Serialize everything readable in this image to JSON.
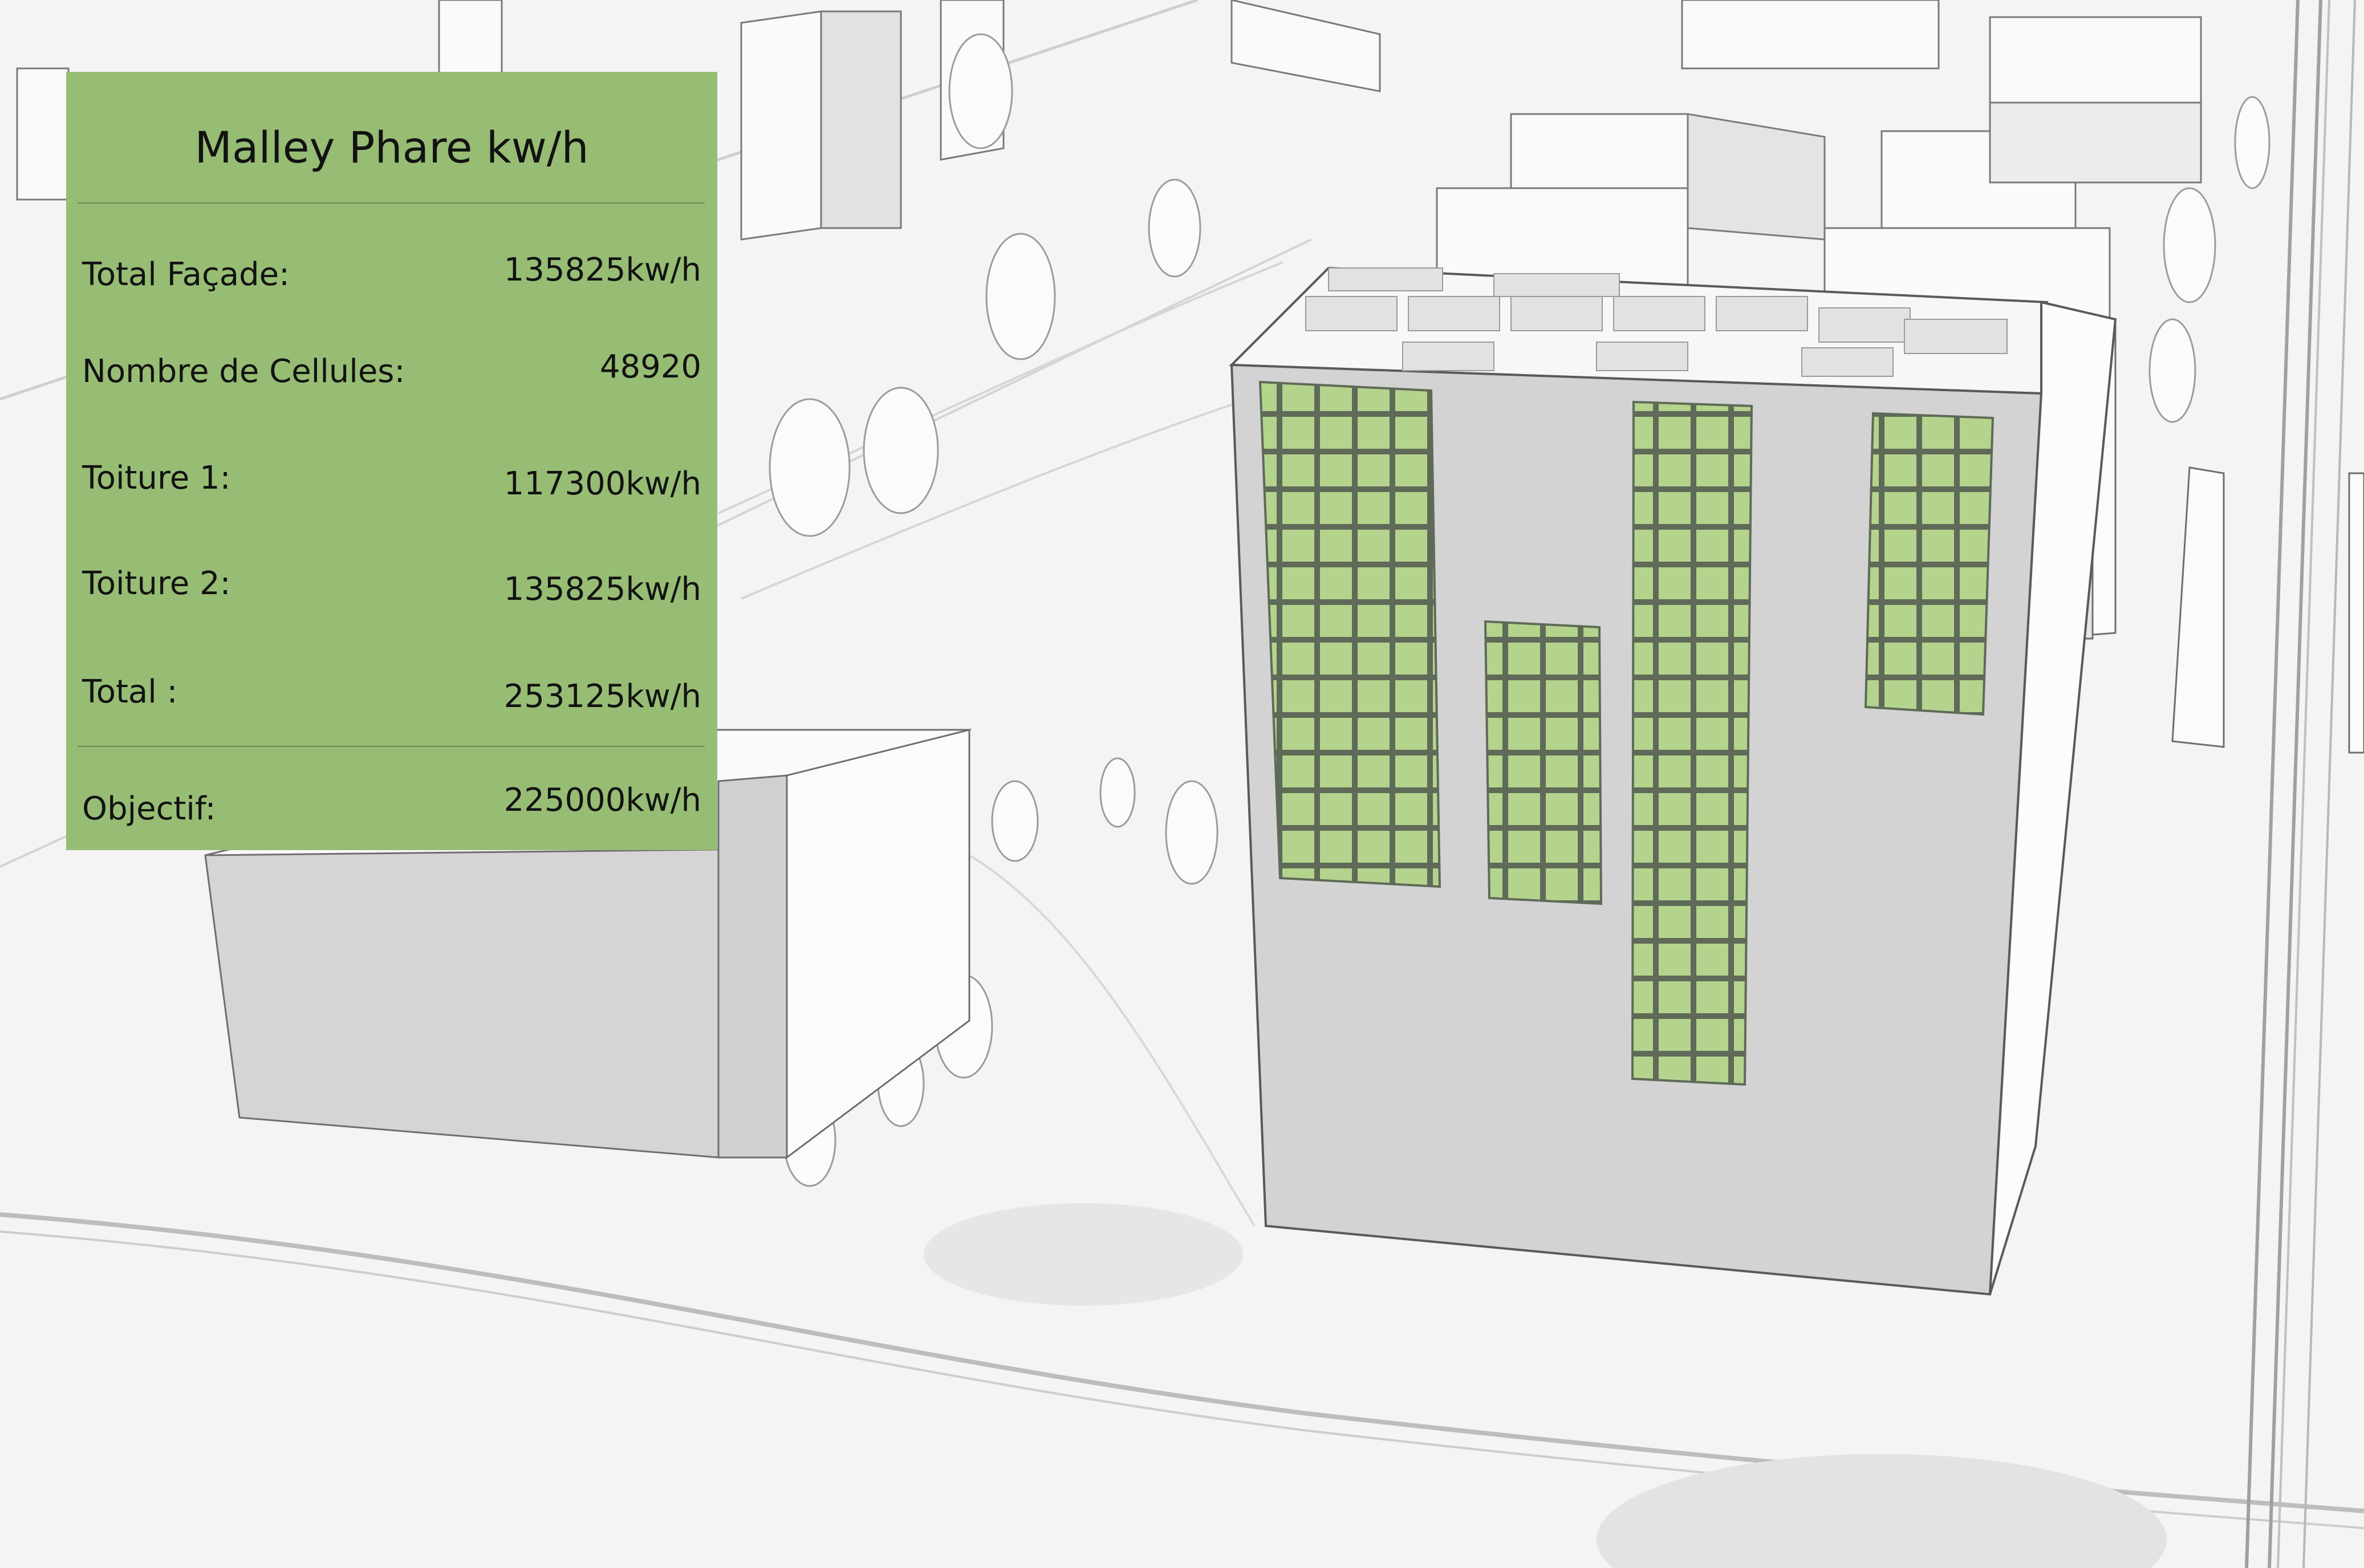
{
  "panel": {
    "title": "Malley Phare kw/h",
    "rows": [
      {
        "label": "Total Façade:",
        "value": "135825kw/h"
      },
      {
        "label": "Nombre de Cellules:",
        "value": "48920"
      },
      {
        "label": "Toiture 1:",
        "value": "117300kw/h"
      },
      {
        "label": "Toiture 2:",
        "value": "135825kw/h"
      },
      {
        "label": "Total :",
        "value": "253125kw/h"
      }
    ],
    "goal": {
      "label": "Objectif:",
      "value": "225000kw/h"
    }
  },
  "colors": {
    "panel_background": "#97bd74",
    "solar_cell_green": "#b4d48d",
    "facade_grey": "#d3d3d3",
    "background": "#f4f4f4"
  }
}
